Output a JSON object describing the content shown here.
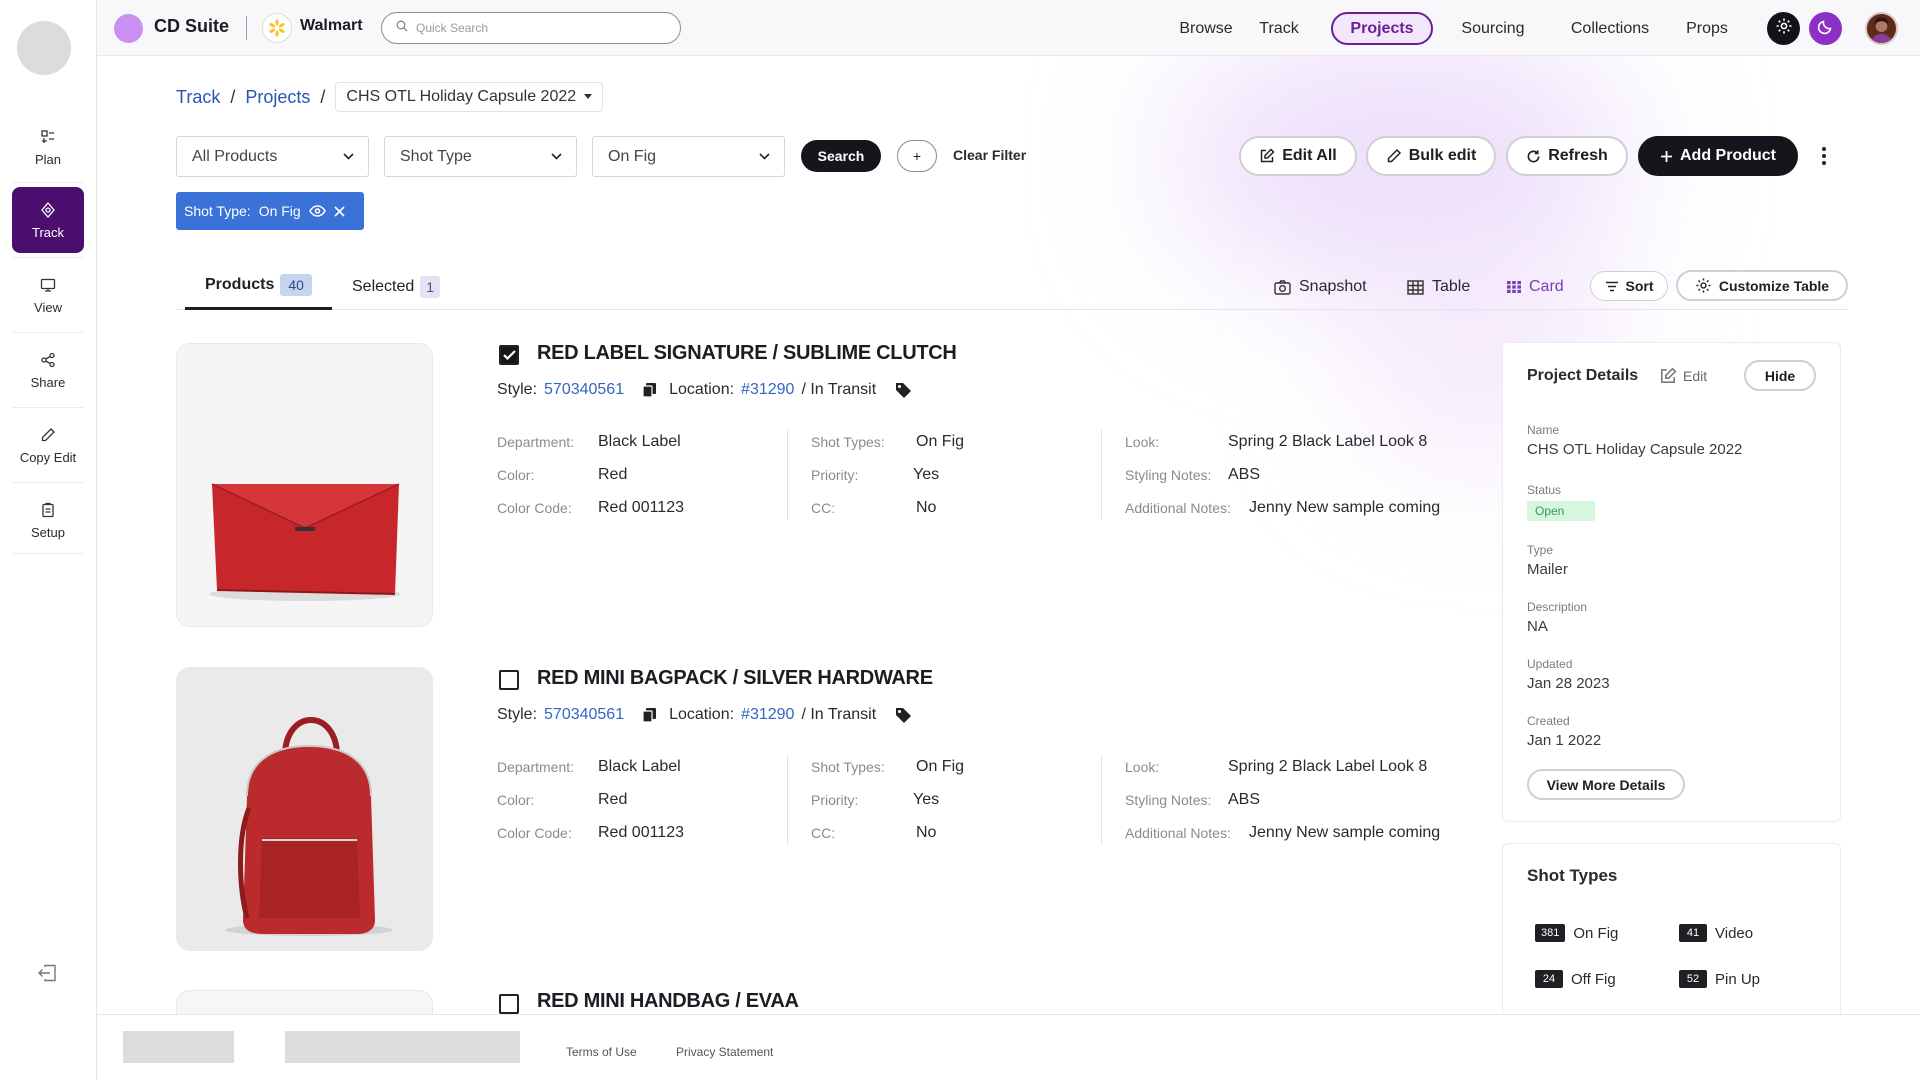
{
  "app": {
    "name": "CD Suite",
    "client": "Walmart"
  },
  "search": {
    "placeholder": "Quick Search"
  },
  "nav": [
    "Browse",
    "Track",
    "Projects",
    "Sourcing",
    "Collections",
    "Props"
  ],
  "nav_active": "Projects",
  "sidebar": {
    "items": [
      {
        "label": "Plan",
        "icon": "plan-icon"
      },
      {
        "label": "Track",
        "icon": "track-icon"
      },
      {
        "label": "View",
        "icon": "monitor-icon"
      },
      {
        "label": "Share",
        "icon": "share-icon"
      },
      {
        "label": "Copy Edit",
        "icon": "pencil-icon"
      },
      {
        "label": "Setup",
        "icon": "clipboard-icon"
      }
    ],
    "active": "Track"
  },
  "breadcrumb": {
    "track": "Track",
    "projects": "Projects",
    "sep": "/",
    "current": "CHS OTL Holiday Capsule 2022"
  },
  "filters": {
    "products": "All Products",
    "shot_type": "Shot Type",
    "on_fig": "On Fig",
    "search": "Search",
    "plus": "+",
    "clear": "Clear Filter"
  },
  "actions": {
    "edit_all": "Edit All",
    "bulk_edit": "Bulk edit",
    "refresh": "Refresh",
    "add_product": "Add Product"
  },
  "chip": {
    "label": "Shot Type:",
    "value": "On Fig"
  },
  "tabs": {
    "products": {
      "label": "Products",
      "count": "40"
    },
    "selected": {
      "label": "Selected",
      "count": "1"
    }
  },
  "views": {
    "snapshot": "Snapshot",
    "table": "Table",
    "card": "Card",
    "sort": "Sort",
    "customize": "Customize Table"
  },
  "labels": {
    "style": "Style:",
    "location": "Location:",
    "department": "Department:",
    "color": "Color:",
    "color_code": "Color Code:",
    "shot_types": "Shot Types:",
    "priority": "Priority:",
    "cc": "CC:",
    "look": "Look:",
    "styling_notes": "Styling Notes:",
    "additional_notes": "Additional Notes:"
  },
  "products": [
    {
      "title": "RED LABEL SIGNATURE / SUBLIME CLUTCH",
      "checked": true,
      "style": "570340561",
      "location": "#31290",
      "location_status": "/ In Transit",
      "department": "Black Label",
      "color": "Red",
      "color_code": "Red 001123",
      "shot_types": "On Fig",
      "priority": "Yes",
      "cc": "No",
      "look": "Spring 2 Black Label Look 8",
      "styling_notes": "ABS",
      "additional_notes": "Jenny New sample coming"
    },
    {
      "title": "RED MINI BAGPACK / SILVER HARDWARE",
      "checked": false,
      "style": "570340561",
      "location": "#31290",
      "location_status": "/ In Transit",
      "department": "Black Label",
      "color": "Red",
      "color_code": "Red 001123",
      "shot_types": "On Fig",
      "priority": "Yes",
      "cc": "No",
      "look": "Spring 2 Black Label Look 8",
      "styling_notes": "ABS",
      "additional_notes": "Jenny New sample coming"
    },
    {
      "title": "RED MINI HANDBAG / EVAA",
      "checked": false
    }
  ],
  "project_details": {
    "title": "Project Details",
    "edit": "Edit",
    "hide": "Hide",
    "name_label": "Name",
    "name": "CHS OTL Holiday Capsule 2022",
    "status_label": "Status",
    "status": "Open",
    "type_label": "Type",
    "type": "Mailer",
    "description_label": "Description",
    "description": "NA",
    "updated_label": "Updated",
    "updated": "Jan 28 2023",
    "created_label": "Created",
    "created": "Jan 1 2022",
    "more": "View More Details"
  },
  "shot_types": {
    "title": "Shot Types",
    "items": [
      {
        "count": "381",
        "label": "On Fig"
      },
      {
        "count": "41",
        "label": "Video"
      },
      {
        "count": "24",
        "label": "Off Fig"
      },
      {
        "count": "52",
        "label": "Pin Up"
      }
    ]
  },
  "footer": {
    "terms": "Terms of Use",
    "privacy": "Privacy Statement"
  },
  "colors": {
    "accent": "#4b0d6e",
    "link": "#3465c4",
    "chip": "#3a72d8",
    "open": "#2f9a56"
  }
}
